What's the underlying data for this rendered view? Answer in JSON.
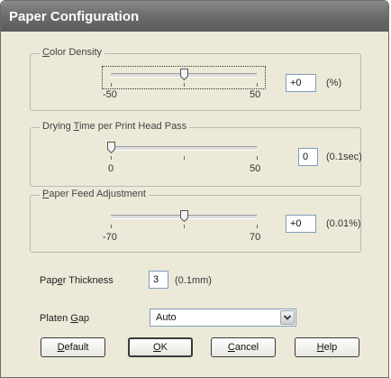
{
  "window": {
    "title": "Paper Configuration"
  },
  "color_density": {
    "label_pre": "",
    "label_ul": "C",
    "label_post": "olor Density",
    "min_label": "-50",
    "max_label": "50",
    "value": "+0",
    "unit": "(%)",
    "level": 0.5
  },
  "drying_time": {
    "label_pre": "Drying ",
    "label_ul": "T",
    "label_post": "ime per Print Head Pass",
    "min_label": "0",
    "max_label": "50",
    "value": "0",
    "unit": "(0.1sec)",
    "level": 0.0
  },
  "paper_feed": {
    "label_pre": "",
    "label_ul": "P",
    "label_post": "aper Feed Adjustment",
    "min_label": "-70",
    "max_label": "70",
    "value": "+0",
    "unit": "(0.01%)",
    "level": 0.5
  },
  "paper_thickness": {
    "label_pre": "Pap",
    "label_ul": "e",
    "label_post": "r Thickness",
    "value": "3",
    "unit": "(0.1mm)"
  },
  "platen_gap": {
    "label_pre": "Platen ",
    "label_ul": "G",
    "label_post": "ap",
    "selected": "Auto"
  },
  "buttons": {
    "default": {
      "ul": "D",
      "rest": "efault"
    },
    "ok": {
      "ul": "O",
      "rest": "K"
    },
    "cancel": {
      "ul": "C",
      "rest": "ancel"
    },
    "help": {
      "ul": "H",
      "rest": "elp"
    }
  }
}
